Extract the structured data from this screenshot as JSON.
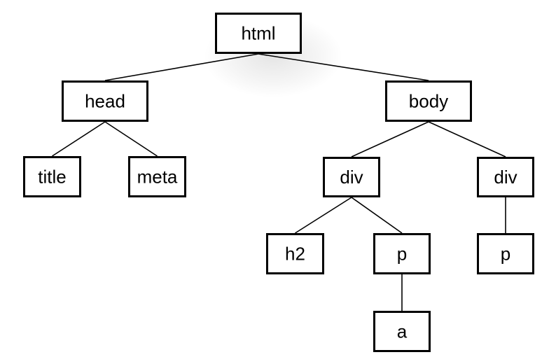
{
  "tree": {
    "nodes": [
      {
        "id": "html",
        "label": "html"
      },
      {
        "id": "head",
        "label": "head",
        "parent": "html"
      },
      {
        "id": "body",
        "label": "body",
        "parent": "html"
      },
      {
        "id": "title",
        "label": "title",
        "parent": "head"
      },
      {
        "id": "meta",
        "label": "meta",
        "parent": "head"
      },
      {
        "id": "div1",
        "label": "div",
        "parent": "body"
      },
      {
        "id": "div2",
        "label": "div",
        "parent": "body"
      },
      {
        "id": "h2",
        "label": "h2",
        "parent": "div1"
      },
      {
        "id": "p1",
        "label": "p",
        "parent": "div1"
      },
      {
        "id": "p2",
        "label": "p",
        "parent": "div2"
      },
      {
        "id": "a",
        "label": "a",
        "parent": "p1"
      }
    ]
  }
}
